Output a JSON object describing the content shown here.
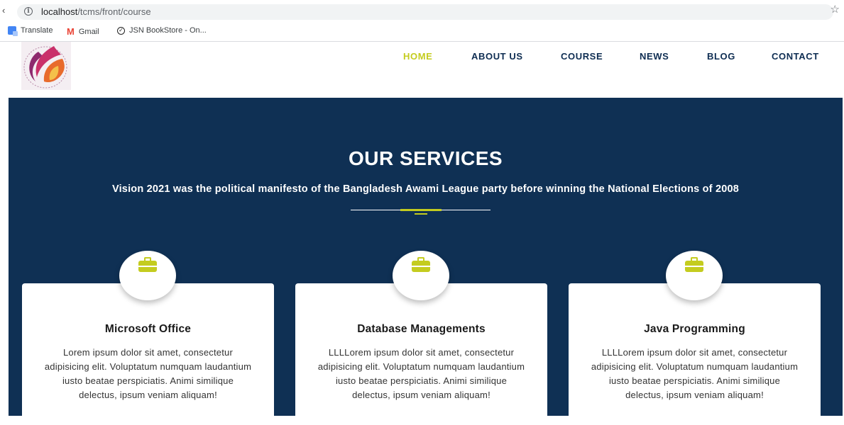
{
  "browser": {
    "back_glyph": "‹",
    "url_host": "localhost",
    "url_path": "/tcms/front/course",
    "bookmarks": [
      "Translate",
      "Gmail",
      "JSN BookStore - On..."
    ]
  },
  "nav": {
    "items": [
      "HOME",
      "ABOUT US",
      "COURSE",
      "NEWS",
      "BLOG",
      "CONTACT"
    ],
    "active": "HOME"
  },
  "hero": {
    "title": "OUR SERVICES",
    "subtitle": "Vision 2021 was the political manifesto of the Bangladesh Awami League party before winning the National Elections of 2008"
  },
  "cards": [
    {
      "icon": "briefcase-icon",
      "title": "Microsoft Office",
      "text": "Lorem ipsum dolor sit amet, consectetur adipisicing elit. Voluptatum numquam laudantium iusto beatae perspiciatis. Animi similique delectus, ipsum veniam aliquam!"
    },
    {
      "icon": "briefcase-icon",
      "title": "Database Managements",
      "text": "LLLLorem ipsum dolor sit amet, consectetur adipisicing elit. Voluptatum numquam laudantium iusto beatae perspiciatis. Animi similique delectus, ipsum veniam aliquam!"
    },
    {
      "icon": "briefcase-icon",
      "title": "Java Programming",
      "text": "LLLLorem ipsum dolor sit amet, consectetur adipisicing elit. Voluptatum numquam laudantium iusto beatae perspiciatis. Animi similique delectus, ipsum veniam aliquam!"
    }
  ],
  "colors": {
    "accent": "#c4cc1f",
    "hero_bg": "#0f3054",
    "nav_text": "#0e2d52"
  }
}
